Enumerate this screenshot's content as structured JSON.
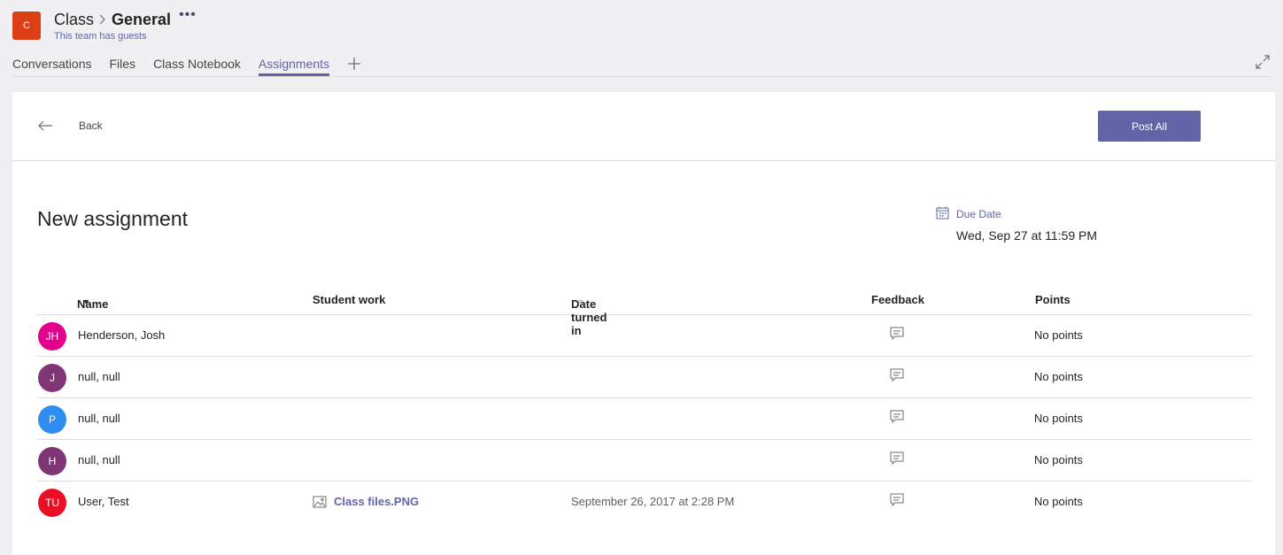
{
  "header": {
    "team_initial": "C",
    "breadcrumb_team": "Class",
    "breadcrumb_channel": "General",
    "more_label": "•••",
    "subtitle": "This team has guests"
  },
  "tabs": [
    {
      "label": "Conversations",
      "active": false
    },
    {
      "label": "Files",
      "active": false
    },
    {
      "label": "Class Notebook",
      "active": false
    },
    {
      "label": "Assignments",
      "active": true
    }
  ],
  "icons": {
    "add_tab": "plus-icon",
    "expand": "expand-icon",
    "back": "arrow-left-icon",
    "calendar": "calendar-icon",
    "feedback": "comment-icon",
    "image": "image-file-icon"
  },
  "toolbar": {
    "back_label": "Back",
    "post_all_label": "Post All"
  },
  "assignment": {
    "title": "New assignment",
    "due_label": "Due Date",
    "due_value": "Wed, Sep 27 at 11:59 PM"
  },
  "table": {
    "headers": {
      "name": "Name",
      "student_work": "Student work",
      "date_turned_in": "Date turned in",
      "feedback": "Feedback",
      "points": "Points"
    },
    "rows": [
      {
        "initials": "JH",
        "avatar_color": "#e3008c",
        "name": "Henderson, Josh",
        "work": "",
        "date": "",
        "points": "No points"
      },
      {
        "initials": "J",
        "avatar_color": "#803575",
        "name": "null, null",
        "work": "",
        "date": "",
        "points": "No points"
      },
      {
        "initials": "P",
        "avatar_color": "#2d8ef0",
        "name": "null, null",
        "work": "",
        "date": "",
        "points": "No points"
      },
      {
        "initials": "H",
        "avatar_color": "#803575",
        "name": "null, null",
        "work": "",
        "date": "",
        "points": "No points"
      },
      {
        "initials": "TU",
        "avatar_color": "#e81123",
        "name": "User, Test",
        "work": "Class files.PNG",
        "date": "September 26, 2017 at 2:28 PM",
        "points": "No points"
      }
    ]
  },
  "colors": {
    "accent": "#6264a7",
    "team_avatar": "#dc3e15"
  }
}
